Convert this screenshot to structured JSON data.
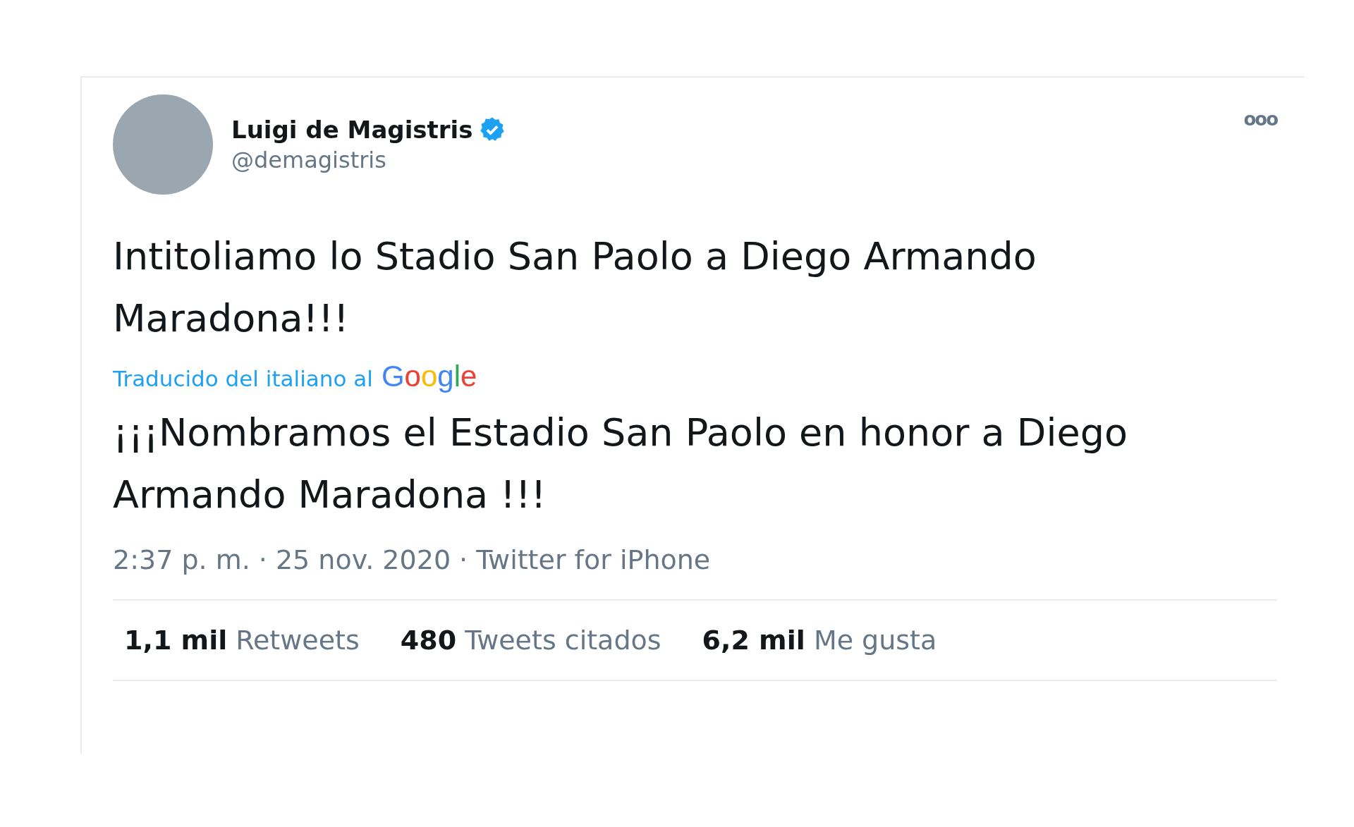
{
  "author": {
    "name": "Luigi de Magistris",
    "verified": true,
    "handle": "@demagistris"
  },
  "more": "ooo",
  "tweet": {
    "text": "Intitoliamo lo Stadio San Paolo a Diego Armando Maradona!!!",
    "translated_by": "Traducido del italiano al",
    "translator": "Google",
    "translation": "¡¡¡Nombramos el Estadio San Paolo en honor a Diego Armando Maradona !!!"
  },
  "meta": {
    "time": "2:37 p. m.",
    "separator_1": "·",
    "date": "25 nov. 2020",
    "separator_2": "·",
    "source": "Twitter for iPhone"
  },
  "stats": [
    {
      "count": "1,1 mil",
      "label": "Retweets"
    },
    {
      "count": "480",
      "label": "Tweets citados"
    },
    {
      "count": "6,2 mil",
      "label": "Me gusta"
    }
  ]
}
